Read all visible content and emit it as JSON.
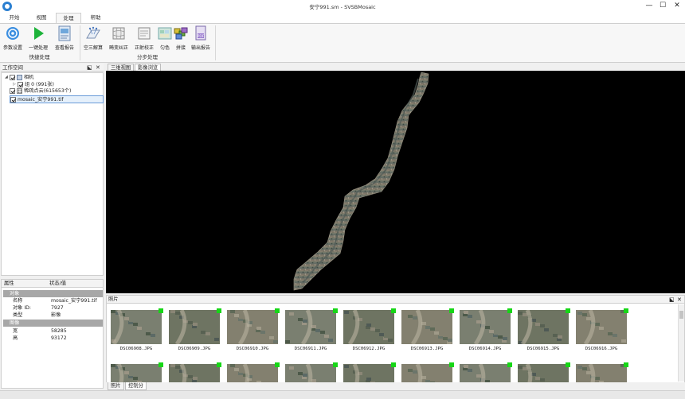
{
  "window": {
    "title": "安宁991.sm - SVSBMosaic",
    "minimize": "—",
    "maximize": "☐",
    "close": "✕"
  },
  "menu_tabs": [
    {
      "label": "开始",
      "active": false
    },
    {
      "label": "视图",
      "active": false
    },
    {
      "label": "处理",
      "active": true
    },
    {
      "label": "帮助",
      "active": false
    }
  ],
  "ribbon": {
    "quick_group": "快捷处理",
    "step_group": "分步处理",
    "buttons": [
      {
        "label": "参数设置",
        "icon": "gear-icon"
      },
      {
        "label": "一键处理",
        "icon": "play-icon"
      },
      {
        "label": "查看报告",
        "icon": "report-icon"
      },
      {
        "label": "空三解算",
        "icon": "aerial-triangulation-icon"
      },
      {
        "label": "畸变纠正",
        "icon": "distortion-icon"
      },
      {
        "label": "正射校正",
        "icon": "orthorectify-icon"
      },
      {
        "label": "匀色",
        "icon": "color-balance-icon"
      },
      {
        "label": "拼接",
        "icon": "mosaic-icon"
      },
      {
        "label": "输出报告",
        "icon": "export-report-icon"
      }
    ]
  },
  "workspace": {
    "title": "工作空间",
    "pin": "⬕",
    "close": "✕",
    "tree": [
      {
        "label": "相机",
        "checked": true,
        "expander": "◢"
      },
      {
        "label": "组 0 (991张)",
        "checked": true,
        "expander": "▷"
      },
      {
        "label": "稀疏点云(615653个)",
        "checked": true,
        "expander": ""
      },
      {
        "label": "mosaic_安宁991.tif",
        "checked": true,
        "expander": ""
      }
    ]
  },
  "properties": {
    "col_name": "属性",
    "col_value": "状态/值",
    "sections": [
      {
        "title": "对象",
        "rows": [
          {
            "key": "名称",
            "value": "mosaic_安宁991.tif"
          },
          {
            "key": "对象 ID:",
            "value": "7927"
          },
          {
            "key": "类型",
            "value": "影像"
          }
        ]
      },
      {
        "title": "图像",
        "rows": [
          {
            "key": "宽",
            "value": "58285"
          },
          {
            "key": "高",
            "value": "93172"
          }
        ]
      }
    ]
  },
  "viewer_tabs": [
    {
      "label": "三维视图",
      "active": false
    },
    {
      "label": "影像浏览",
      "active": true
    }
  ],
  "photos": {
    "title": "照片",
    "pin": "⬕",
    "close": "✕",
    "row1": [
      "DSC06908.JPG",
      "DSC06909.JPG",
      "DSC06910.JPG",
      "DSC06911.JPG",
      "DSC06912.JPG",
      "DSC06913.JPG",
      "DSC06914.JPG",
      "DSC06915.JPG",
      "DSC06916.JPG"
    ],
    "row2_count": 9
  },
  "bottom_tabs": [
    {
      "label": "照片",
      "active": false
    },
    {
      "label": "控制分",
      "active": true
    }
  ],
  "colors": {
    "accent": "#2a7fd1",
    "play": "#1db33a",
    "flag": "#16d616",
    "section": "#a7a7a7"
  }
}
